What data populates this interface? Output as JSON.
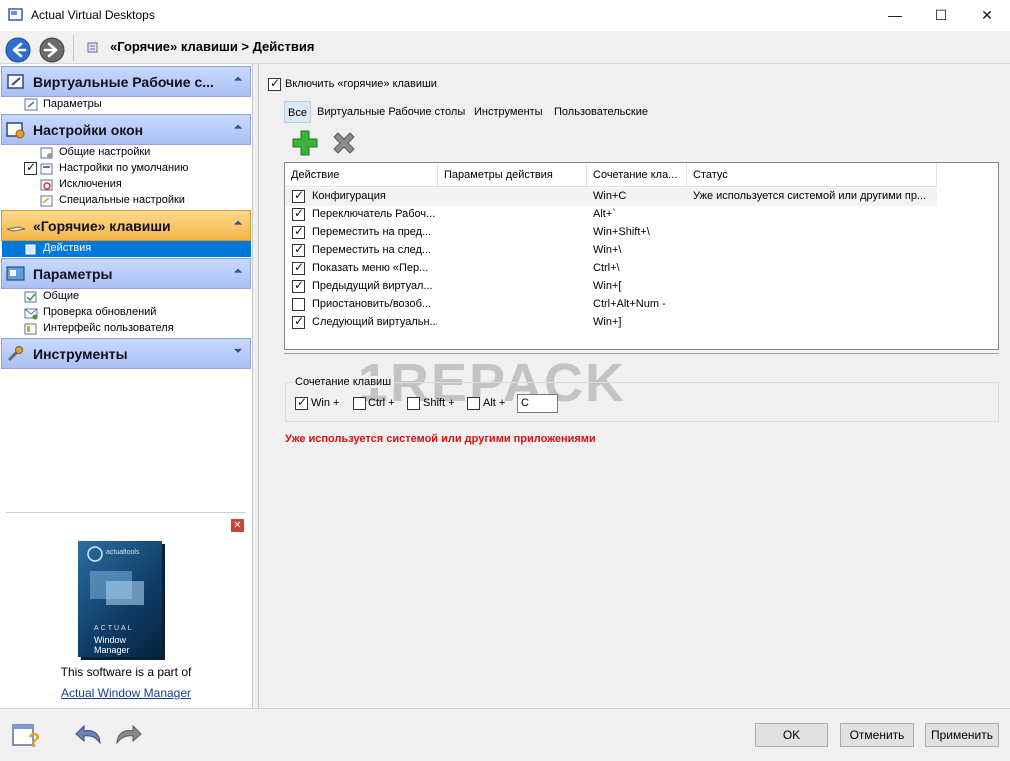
{
  "window": {
    "title": "Actual Virtual Desktops",
    "minimize": "—",
    "maximize": "☐",
    "close": "✕"
  },
  "nav": {
    "breadcrumb": "«Горячие» клавиши > Действия"
  },
  "sidebar": {
    "groups": [
      {
        "label": "Виртуальные Рабочие с...",
        "icon": "virtual-desktop-icon",
        "chevron": "⏶",
        "items": [
          {
            "label": "Параметры",
            "icon": "settings-icon"
          }
        ]
      },
      {
        "label": "Настройки окон",
        "icon": "window-settings-icon",
        "chevron": "⏶",
        "items": [
          {
            "label": "Общие настройки",
            "icon": "general-settings-icon"
          },
          {
            "label": "Настройки по умолчанию",
            "icon": "default-settings-icon",
            "checked": true
          },
          {
            "label": "Исключения",
            "icon": "exclusions-icon"
          },
          {
            "label": "Специальные настройки",
            "icon": "special-settings-icon"
          }
        ]
      },
      {
        "label": "«Горячие» клавиши",
        "icon": "keyboard-icon",
        "chevron": "⏶",
        "active": true,
        "items": [
          {
            "label": "Действия",
            "icon": "actions-icon",
            "selected": true
          }
        ]
      },
      {
        "label": "Параметры",
        "icon": "options-icon",
        "chevron": "⏶",
        "items": [
          {
            "label": "Общие",
            "icon": "general-icon"
          },
          {
            "label": "Проверка обновлений",
            "icon": "update-check-icon"
          },
          {
            "label": "Интерфейс пользователя",
            "icon": "user-interface-icon"
          }
        ]
      },
      {
        "label": "Инструменты",
        "icon": "tools-icon",
        "chevron": "⏷",
        "items": []
      }
    ],
    "promo": {
      "close": "✕",
      "box_brand": "actualtools",
      "box_title": "ACTUAL",
      "box_product": "Window Manager",
      "text": "This software is a part of",
      "link": "Actual Window Manager"
    }
  },
  "main": {
    "enable_checkbox": {
      "label": "Включить «горячие» клавиши",
      "checked": true
    },
    "tabs": [
      {
        "label": "Все",
        "selected": true
      },
      {
        "label": "Виртуальные Рабочие столы"
      },
      {
        "label": "Инструменты"
      },
      {
        "label": "Пользовательские"
      }
    ],
    "toolbar": {
      "add": "add-icon",
      "delete": "delete-icon"
    },
    "table": {
      "columns": [
        "Действие",
        "Параметры действия",
        "Сочетание кла...",
        "Статус"
      ],
      "rows": [
        {
          "checked": true,
          "action": "Конфигурация",
          "params": "",
          "hotkey": "Win+C",
          "status": "Уже используется системой или другими пр...",
          "selected": true
        },
        {
          "checked": true,
          "action": "Переключатель Рабоч...",
          "params": "",
          "hotkey": "Alt+`",
          "status": ""
        },
        {
          "checked": true,
          "action": "Переместить на пред...",
          "params": "",
          "hotkey": "Win+Shift+\\",
          "status": ""
        },
        {
          "checked": true,
          "action": "Переместить на след...",
          "params": "",
          "hotkey": "Win+\\",
          "status": ""
        },
        {
          "checked": true,
          "action": "Показать меню «Пер...",
          "params": "",
          "hotkey": "Ctrl+\\",
          "status": ""
        },
        {
          "checked": true,
          "action": "Предыдущий виртуал...",
          "params": "",
          "hotkey": "Win+[",
          "status": ""
        },
        {
          "checked": false,
          "action": "Приостановить/возоб...",
          "params": "",
          "hotkey": "Ctrl+Alt+Num -",
          "status": ""
        },
        {
          "checked": true,
          "action": "Следующий виртуальн...",
          "params": "",
          "hotkey": "Win+]",
          "status": ""
        }
      ]
    },
    "hotkey_editor": {
      "legend": "Сочетание клавиш",
      "modifiers": [
        {
          "label": "Win +",
          "checked": true
        },
        {
          "label": "Ctrl +",
          "checked": false
        },
        {
          "label": "Shift +",
          "checked": false
        },
        {
          "label": "Alt +",
          "checked": false
        }
      ],
      "key_value": "C"
    },
    "warning": "Уже используется системой или другими приложениями",
    "watermark": "1REPACK"
  },
  "footer": {
    "ok": "OK",
    "cancel": "Отменить",
    "apply": "Применить",
    "icons": [
      "help-icon",
      "undo-icon",
      "redo-icon"
    ]
  },
  "colors": {
    "group_header": "#a9c0f2",
    "active_group": "#f3b54a",
    "selection": "#0078d7",
    "warning": "#e01010"
  }
}
